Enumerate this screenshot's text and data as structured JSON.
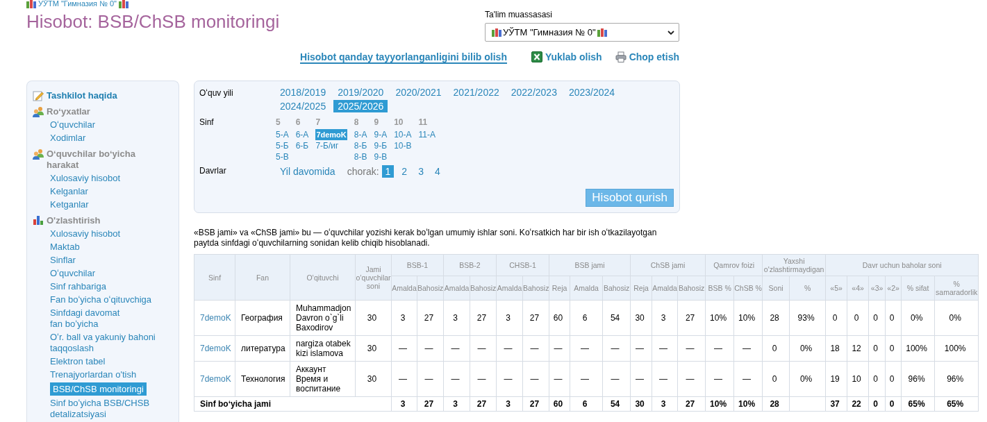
{
  "breadcrumb": "УЎТМ \"Гимназия № 0\"",
  "title": "Hisobot: BSB/ChSB monitoringi",
  "institution": {
    "label": "Ta'lim muassasasi",
    "value": "УЎТМ \"Гимназия № 0\""
  },
  "actions": [
    {
      "kind": "help",
      "label": "Hisobot qanday tayyorlanganligini bilib olish"
    },
    {
      "kind": "excel",
      "label": "Yuklab olish"
    },
    {
      "kind": "print",
      "label": "Chop etish"
    }
  ],
  "sidebar": [
    {
      "kind": "link",
      "label": "Tashkilot haqida"
    },
    {
      "kind": "group",
      "label": "Roʻyxatlar",
      "items": [
        {
          "label": "Oʻquvchilar",
          "selected": false
        },
        {
          "label": "Xodimlar",
          "selected": false
        }
      ]
    },
    {
      "kind": "group",
      "label": "Oʻquvchilar boʻyicha harakat",
      "items": [
        {
          "label": "Xulosaviy hisobot",
          "selected": false
        },
        {
          "label": "Kelganlar",
          "selected": false
        },
        {
          "label": "Ketganlar",
          "selected": false
        }
      ]
    },
    {
      "kind": "group",
      "label": "O'zlashtirish",
      "items": [
        {
          "label": "Xulosaviy hisobot",
          "selected": false
        },
        {
          "label": "Maktab",
          "selected": false
        },
        {
          "label": "Sinflar",
          "selected": false
        },
        {
          "label": "Oʻquvchilar",
          "selected": false
        },
        {
          "label": "Sinf rahbariga",
          "selected": false
        },
        {
          "label": "Fan boʻyicha oʻqituvchiga",
          "selected": false
        },
        {
          "label": "Sinfdagi davomat\nfan boʻyicha",
          "selected": false
        },
        {
          "label": "Oʻr. ball va yakuniy bahoni taqqoslash",
          "selected": false
        },
        {
          "label": "Elektron tabel",
          "selected": false
        },
        {
          "label": "Trenajyorlardan o'tish",
          "selected": false
        },
        {
          "label": "BSB/ChSB monitoringi",
          "selected": true
        },
        {
          "label": "Sinf boʻyicha BSB/CHSB detalizatsiyasi",
          "selected": false
        }
      ]
    }
  ],
  "filters": {
    "years": {
      "label": "Oʻquv yili",
      "options": [
        {
          "label": "2018/2019",
          "selected": false
        },
        {
          "label": "2019/2020",
          "selected": false
        },
        {
          "label": "2020/2021",
          "selected": false
        },
        {
          "label": "2021/2022",
          "selected": false
        },
        {
          "label": "2022/2023",
          "selected": false
        },
        {
          "label": "2023/2024",
          "selected": false
        },
        {
          "label": "2024/2025",
          "selected": false
        },
        {
          "label": "2025/2026",
          "selected": true
        }
      ]
    },
    "classes": {
      "label": "Sinf",
      "grades": [
        {
          "grade": "5",
          "classes": [
            {
              "label": "5-А",
              "selected": false
            },
            {
              "label": "5-Б",
              "selected": false
            },
            {
              "label": "5-В",
              "selected": false
            }
          ]
        },
        {
          "grade": "6",
          "classes": [
            {
              "label": "6-А",
              "selected": false
            },
            {
              "label": "6-Б",
              "selected": false
            }
          ]
        },
        {
          "grade": "7",
          "classes": [
            {
              "label": "7demoK",
              "selected": true
            },
            {
              "label": "7-Б/иг",
              "selected": false
            }
          ]
        },
        {
          "grade": "8",
          "classes": [
            {
              "label": "8-А",
              "selected": false
            },
            {
              "label": "8-Б",
              "selected": false
            },
            {
              "label": "8-В",
              "selected": false
            }
          ]
        },
        {
          "grade": "9",
          "classes": [
            {
              "label": "9-А",
              "selected": false
            },
            {
              "label": "9-Б",
              "selected": false
            },
            {
              "label": "9-В",
              "selected": false
            }
          ]
        },
        {
          "grade": "10",
          "classes": [
            {
              "label": "10-А",
              "selected": false
            },
            {
              "label": "10-В",
              "selected": false
            }
          ]
        },
        {
          "grade": "11",
          "classes": [
            {
              "label": "11-А",
              "selected": false
            }
          ]
        }
      ]
    },
    "periods": {
      "label": "Davrlar",
      "whole_year": {
        "label": "Yil davomida",
        "selected": false
      },
      "quarter_label": "chorak:",
      "quarters": [
        {
          "label": "1",
          "selected": true
        },
        {
          "label": "2",
          "selected": false
        },
        {
          "label": "3",
          "selected": false
        },
        {
          "label": "4",
          "selected": false
        }
      ]
    },
    "submit": "Hisobot qurish"
  },
  "note": "«BSB jami» va «ChSB jami» bu — oʻquvchilar yozishi kerak boʻlgan umumiy ishlar soni. Koʻrsatkich har bir ish oʻtkazilayotgan paytda sinfdagi oʻquvchilarning sonidan kelib chiqib hisoblanadi.",
  "table": {
    "header_rows": [
      [
        {
          "label": "Sinf",
          "rowspan": 2
        },
        {
          "label": "Fan",
          "rowspan": 2
        },
        {
          "label": "Oʻqituvchi",
          "rowspan": 2
        },
        {
          "label": "Jami oʻquvchilar soni",
          "rowspan": 2
        },
        {
          "label": "BSB-1",
          "colspan": 2
        },
        {
          "label": "BSB-2",
          "colspan": 2
        },
        {
          "label": "CHSB-1",
          "colspan": 2
        },
        {
          "label": "BSB jami",
          "colspan": 3
        },
        {
          "label": "ChSB jami",
          "colspan": 3
        },
        {
          "label": "Qamrov foizi",
          "colspan": 2
        },
        {
          "label": "Yaxshi o'zlashtirmaydigan",
          "colspan": 2
        },
        {
          "label": "Davr uchun baholar soni",
          "colspan": 6
        }
      ],
      [
        {
          "label": "Amalda"
        },
        {
          "label": "Bahosiz"
        },
        {
          "label": "Amalda"
        },
        {
          "label": "Bahosiz"
        },
        {
          "label": "Amalda"
        },
        {
          "label": "Bahosiz"
        },
        {
          "label": "Reja"
        },
        {
          "label": "Amalda"
        },
        {
          "label": "Bahosiz"
        },
        {
          "label": "Reja"
        },
        {
          "label": "Amalda"
        },
        {
          "label": "Bahosiz"
        },
        {
          "label": "BSB %"
        },
        {
          "label": "ChSB %"
        },
        {
          "label": "Soni"
        },
        {
          "label": "%"
        },
        {
          "label": "«5»"
        },
        {
          "label": "«4»"
        },
        {
          "label": "«3»"
        },
        {
          "label": "«2»"
        },
        {
          "label": "% sifat"
        },
        {
          "label": "% samaradorlik"
        }
      ]
    ],
    "rows": [
      [
        "7demoK",
        "География",
        "Muhammadjon Davron o`g`li Baxodirov",
        "30",
        "3",
        "27",
        "3",
        "27",
        "3",
        "27",
        "60",
        "6",
        "54",
        "30",
        "3",
        "27",
        "10%",
        "10%",
        "28",
        "93%",
        "0",
        "0",
        "0",
        "0",
        "0%",
        "0%"
      ],
      [
        "7demoK",
        "литература",
        "nargiza otabek kizi islamova",
        "30",
        "—",
        "—",
        "—",
        "—",
        "—",
        "—",
        "—",
        "—",
        "—",
        "—",
        "—",
        "—",
        "—",
        "—",
        "0",
        "0%",
        "18",
        "12",
        "0",
        "0",
        "100%",
        "100%"
      ],
      [
        "7demoK",
        "Технология",
        "Аккаунт Время и воспитание",
        "30",
        "—",
        "—",
        "—",
        "—",
        "—",
        "—",
        "—",
        "—",
        "—",
        "—",
        "—",
        "—",
        "—",
        "—",
        "0",
        "0%",
        "19",
        "10",
        "0",
        "0",
        "96%",
        "96%"
      ]
    ],
    "total_row": [
      {
        "text": "Sinf boʻyicha jami",
        "colspan": 4
      },
      {
        "text": "3"
      },
      {
        "text": "27"
      },
      {
        "text": "3"
      },
      {
        "text": "27"
      },
      {
        "text": "3"
      },
      {
        "text": "27"
      },
      {
        "text": "60"
      },
      {
        "text": "6"
      },
      {
        "text": "54"
      },
      {
        "text": "30"
      },
      {
        "text": "3"
      },
      {
        "text": "27"
      },
      {
        "text": "10%"
      },
      {
        "text": "10%"
      },
      {
        "text": "28"
      },
      {
        "blank": true
      },
      {
        "text": "37"
      },
      {
        "text": "22"
      },
      {
        "text": "0"
      },
      {
        "text": "0"
      },
      {
        "text": "65%"
      },
      {
        "text": "65%"
      }
    ]
  }
}
